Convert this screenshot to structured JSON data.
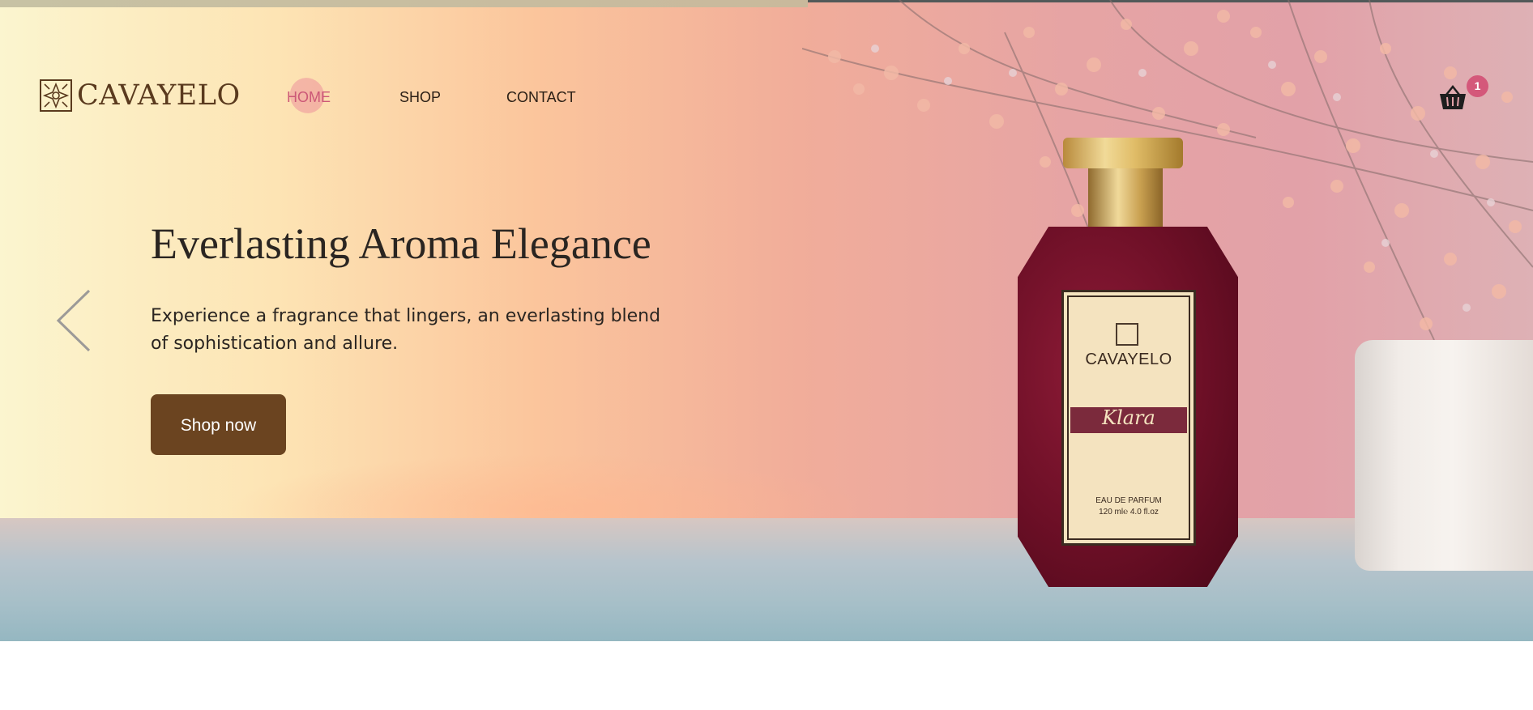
{
  "brand": {
    "name": "CAVAYELO",
    "logo_icon": "ornament-logo-icon"
  },
  "nav": {
    "items": [
      "HOME",
      "SHOP",
      "CONTACT"
    ],
    "active": "HOME"
  },
  "cart": {
    "icon": "basket-icon",
    "count": "1"
  },
  "hero": {
    "title": "Everlasting Aroma Elegance",
    "description": "Experience a fragrance that lingers, an everlasting blend of sophistication and allure.",
    "cta_label": "Shop now",
    "prev_icon": "chevron-left-icon"
  },
  "product_label": {
    "brand": "CAVAYELO",
    "name": "Klara",
    "type": "EAU DE PARFUM",
    "volume": "120 ml℮ 4.0 fl.oz"
  },
  "colors": {
    "accent": "#cc5877",
    "cta": "#6b4420",
    "badge": "#d4587a",
    "brand_text": "#5a3a1e"
  }
}
